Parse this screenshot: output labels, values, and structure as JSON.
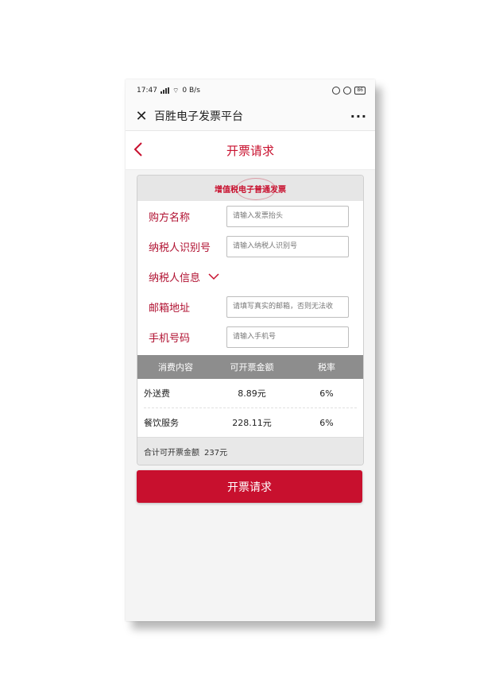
{
  "status_bar": {
    "time": "17:47",
    "network_speed": "0 B/s",
    "battery": "86"
  },
  "title_bar": {
    "title": "百胜电子发票平台",
    "close_icon": "close-icon",
    "more_icon": "more-icon"
  },
  "page_header": {
    "title": "开票请求",
    "back_icon": "chevron-left-icon"
  },
  "invoice_card": {
    "header": "增值税电子普通发票",
    "fields": [
      {
        "label": "购方名称",
        "placeholder": "请输入发票抬头",
        "value": ""
      },
      {
        "label": "纳税人识别号",
        "placeholder": "请输入纳税人识别号",
        "value": ""
      }
    ],
    "taxpayer_info_label": "纳税人信息",
    "contact_fields": [
      {
        "label": "邮箱地址",
        "placeholder": "请填写真实的邮箱，否则无法收",
        "value": ""
      },
      {
        "label": "手机号码",
        "placeholder": "请输入手机号",
        "value": ""
      }
    ],
    "table": {
      "columns": [
        "消费内容",
        "可开票金额",
        "税率"
      ],
      "rows": [
        {
          "item": "外送费",
          "amount": "8.89元",
          "rate": "6%"
        },
        {
          "item": "餐饮服务",
          "amount": "228.11元",
          "rate": "6%"
        }
      ]
    },
    "total_label": "合计可开票金额",
    "total_value": "237元"
  },
  "submit_button": "开票请求",
  "colors": {
    "accent": "#c8102e",
    "table_header": "#8d8d8d",
    "card_header": "#e6e6e6"
  }
}
